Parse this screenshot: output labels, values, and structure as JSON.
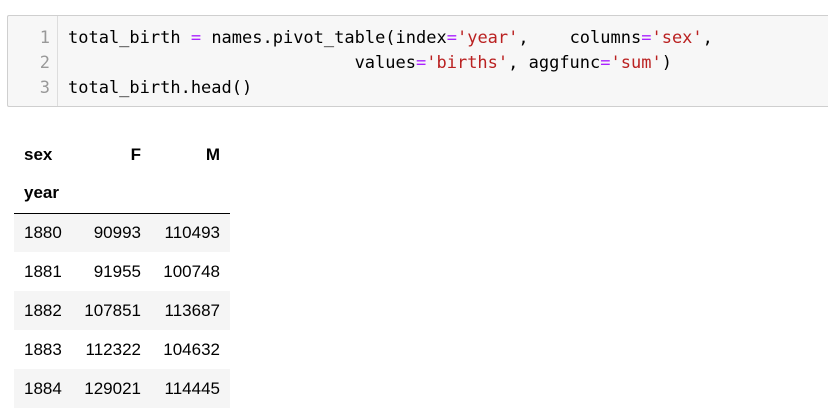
{
  "code_cell": {
    "line_numbers": [
      "1",
      "2",
      "3"
    ],
    "lines": [
      [
        {
          "t": "total_birth ",
          "k": "plain"
        },
        {
          "t": "=",
          "k": "op"
        },
        {
          "t": " names.pivot_table(index",
          "k": "plain"
        },
        {
          "t": "=",
          "k": "op"
        },
        {
          "t": "'year'",
          "k": "str"
        },
        {
          "t": ",    columns",
          "k": "plain"
        },
        {
          "t": "=",
          "k": "op"
        },
        {
          "t": "'sex'",
          "k": "str"
        },
        {
          "t": ",",
          "k": "plain"
        }
      ],
      [
        {
          "t": "                            values",
          "k": "plain"
        },
        {
          "t": "=",
          "k": "op"
        },
        {
          "t": "'births'",
          "k": "str"
        },
        {
          "t": ", aggfunc",
          "k": "plain"
        },
        {
          "t": "=",
          "k": "op"
        },
        {
          "t": "'sum'",
          "k": "str"
        },
        {
          "t": ")",
          "k": "plain"
        }
      ],
      [
        {
          "t": "total_birth.head()",
          "k": "plain"
        }
      ]
    ]
  },
  "colors": {
    "operator": "#aa22ff",
    "string": "#ba2121",
    "cell_background": "#f7f7f7",
    "row_stripe": "#f5f5f5"
  },
  "dataframe": {
    "columns_name": "sex",
    "columns": [
      "F",
      "M"
    ],
    "index_name": "year",
    "rows": [
      {
        "index": "1880",
        "F": "90993",
        "M": "110493"
      },
      {
        "index": "1881",
        "F": "91955",
        "M": "100748"
      },
      {
        "index": "1882",
        "F": "107851",
        "M": "113687"
      },
      {
        "index": "1883",
        "F": "112322",
        "M": "104632"
      },
      {
        "index": "1884",
        "F": "129021",
        "M": "114445"
      }
    ]
  }
}
